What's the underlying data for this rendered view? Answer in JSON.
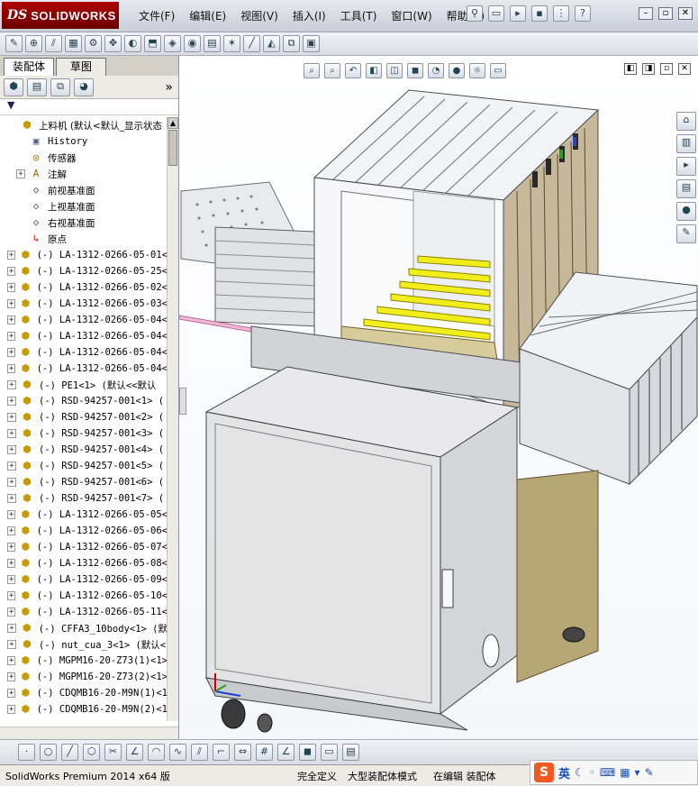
{
  "app": {
    "logo_ds": "DS",
    "logo_name": "SOLIDWORKS"
  },
  "menu": [
    "文件(F)",
    "编辑(E)",
    "视图(V)",
    "插入(I)",
    "工具(T)",
    "窗口(W)",
    "帮助(H)"
  ],
  "panel": {
    "tabs": [
      "装配体",
      "草图"
    ],
    "active_tab": 0,
    "more": "»",
    "filter": "▼"
  },
  "tree": [
    {
      "label": "上料机  (默认<默认_显示状态",
      "icon": "assembly-icon",
      "glyph": "⬢",
      "exp": "",
      "root": true
    },
    {
      "label": "History",
      "icon": "history-icon",
      "glyph": "▣",
      "exp": ""
    },
    {
      "label": "传感器",
      "icon": "sensor-icon",
      "glyph": "◎",
      "exp": ""
    },
    {
      "label": "注解",
      "icon": "annotation-icon",
      "glyph": "A",
      "exp": "+"
    },
    {
      "label": "前视基准面",
      "icon": "plane-icon",
      "glyph": "◇",
      "exp": ""
    },
    {
      "label": "上视基准面",
      "icon": "plane-icon",
      "glyph": "◇",
      "exp": ""
    },
    {
      "label": "右视基准面",
      "icon": "plane-icon",
      "glyph": "◇",
      "exp": ""
    },
    {
      "label": "原点",
      "icon": "origin-icon",
      "glyph": "↳",
      "exp": ""
    },
    {
      "label": "(-) LA-1312-0266-05-01<",
      "icon": "subassembly-icon",
      "glyph": "⬢",
      "exp": "+"
    },
    {
      "label": "(-) LA-1312-0266-05-25<",
      "icon": "subassembly-icon",
      "glyph": "⬢",
      "exp": "+"
    },
    {
      "label": "(-) LA-1312-0266-05-02<",
      "icon": "subassembly-icon",
      "glyph": "⬢",
      "exp": "+"
    },
    {
      "label": "(-) LA-1312-0266-05-03<",
      "icon": "subassembly-icon",
      "glyph": "⬢",
      "exp": "+"
    },
    {
      "label": "(-) LA-1312-0266-05-04<",
      "icon": "subassembly-icon",
      "glyph": "⬢",
      "exp": "+"
    },
    {
      "label": "(-) LA-1312-0266-05-04<",
      "icon": "subassembly-icon",
      "glyph": "⬢",
      "exp": "+"
    },
    {
      "label": "(-) LA-1312-0266-05-04<",
      "icon": "subassembly-icon",
      "glyph": "⬢",
      "exp": "+"
    },
    {
      "label": "(-) LA-1312-0266-05-04<",
      "icon": "subassembly-icon",
      "glyph": "⬢",
      "exp": "+"
    },
    {
      "label": "(-) PE1<1> (默认<<默认",
      "icon": "subassembly-icon",
      "glyph": "⬢",
      "exp": "+"
    },
    {
      "label": "(-) RSD-94257-001<1>  (",
      "icon": "subassembly-icon",
      "glyph": "⬢",
      "exp": "+"
    },
    {
      "label": "(-) RSD-94257-001<2>  (",
      "icon": "subassembly-icon",
      "glyph": "⬢",
      "exp": "+"
    },
    {
      "label": "(-) RSD-94257-001<3>  (",
      "icon": "subassembly-icon",
      "glyph": "⬢",
      "exp": "+"
    },
    {
      "label": "(-) RSD-94257-001<4>  (",
      "icon": "subassembly-icon",
      "glyph": "⬢",
      "exp": "+"
    },
    {
      "label": "(-) RSD-94257-001<5>  (",
      "icon": "subassembly-icon",
      "glyph": "⬢",
      "exp": "+"
    },
    {
      "label": "(-) RSD-94257-001<6>  (",
      "icon": "subassembly-icon",
      "glyph": "⬢",
      "exp": "+"
    },
    {
      "label": "(-) RSD-94257-001<7>  (",
      "icon": "subassembly-icon",
      "glyph": "⬢",
      "exp": "+"
    },
    {
      "label": "(-) LA-1312-0266-05-05<",
      "icon": "subassembly-icon",
      "glyph": "⬢",
      "exp": "+"
    },
    {
      "label": "(-) LA-1312-0266-05-06<",
      "icon": "subassembly-icon",
      "glyph": "⬢",
      "exp": "+"
    },
    {
      "label": "(-) LA-1312-0266-05-07<",
      "icon": "subassembly-icon",
      "glyph": "⬢",
      "exp": "+"
    },
    {
      "label": "(-) LA-1312-0266-05-08<",
      "icon": "subassembly-icon",
      "glyph": "⬢",
      "exp": "+"
    },
    {
      "label": "(-) LA-1312-0266-05-09<",
      "icon": "subassembly-icon",
      "glyph": "⬢",
      "exp": "+"
    },
    {
      "label": "(-) LA-1312-0266-05-10<",
      "icon": "subassembly-icon",
      "glyph": "⬢",
      "exp": "+"
    },
    {
      "label": "(-) LA-1312-0266-05-11<",
      "icon": "subassembly-icon",
      "glyph": "⬢",
      "exp": "+"
    },
    {
      "label": "(-) CFFA3_10body<1>  (默",
      "icon": "subassembly-icon",
      "glyph": "⬢",
      "exp": "+"
    },
    {
      "label": "(-) nut_cua_3<1> (默认<",
      "icon": "subassembly-icon",
      "glyph": "⬢",
      "exp": "+"
    },
    {
      "label": "(-) MGPM16-20-Z73(1)<1>",
      "icon": "subassembly-icon",
      "glyph": "⬢",
      "exp": "+"
    },
    {
      "label": "(-) MGPM16-20-Z73(2)<1>",
      "icon": "subassembly-icon",
      "glyph": "⬢",
      "exp": "+"
    },
    {
      "label": "(-) CDQMB16-20-M9N(1)<1",
      "icon": "subassembly-icon",
      "glyph": "⬢",
      "exp": "+"
    },
    {
      "label": "(-) CDQMB16-20-M9N(2)<1",
      "icon": "subassembly-icon",
      "glyph": "⬢",
      "exp": "+"
    }
  ],
  "status": {
    "product": "SolidWorks Premium 2014 x64 版",
    "state": "完全定义",
    "mode": "大型装配体模式",
    "editing": "在编辑 装配体"
  },
  "ime": {
    "logo": "S",
    "lang": "英"
  },
  "colors": {
    "cabinet": "#e4e4e4",
    "panel_olive": "#b6a775",
    "highlight_yellow": "#f2ee1e",
    "frame_gray": "#cfd0d4"
  }
}
